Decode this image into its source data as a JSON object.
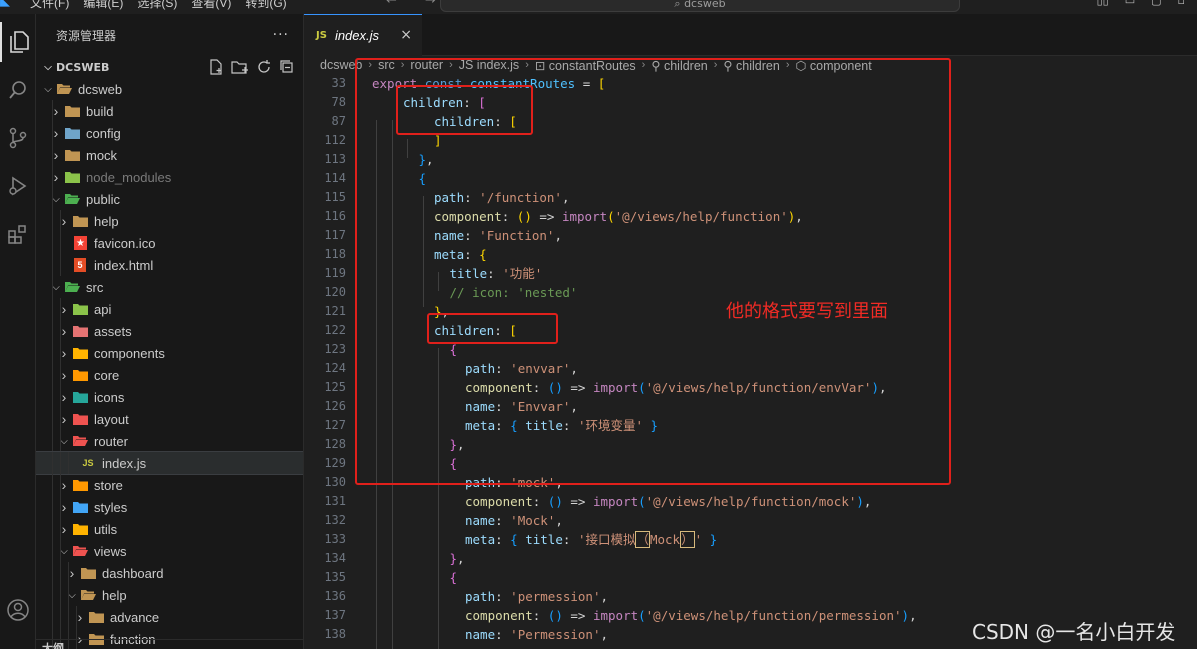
{
  "titlebar": {
    "menu": [
      "文件(F)",
      "编辑(E)",
      "选择(S)",
      "查看(V)",
      "转到(G)"
    ],
    "more": "···",
    "nav": "← →",
    "search": "⌕ dcsweb",
    "window_controls": [
      "▯▯",
      "▭",
      "▢",
      "▫"
    ]
  },
  "sidebar": {
    "title": "资源管理器",
    "more": "···",
    "section": "DCSWEB",
    "outline": "大纲",
    "items": [
      {
        "label": "dcsweb",
        "depth": 1,
        "open": true,
        "icon": "folder",
        "color": "#c09553"
      },
      {
        "label": "build",
        "depth": 2,
        "open": false,
        "icon": "folder",
        "color": "#c09553"
      },
      {
        "label": "config",
        "depth": 2,
        "open": false,
        "icon": "folder",
        "color": "#6fa4c9"
      },
      {
        "label": "mock",
        "depth": 2,
        "open": false,
        "icon": "folder",
        "color": "#c09553"
      },
      {
        "label": "node_modules",
        "depth": 2,
        "open": false,
        "icon": "folder",
        "color": "#8bc34a",
        "dim": true
      },
      {
        "label": "public",
        "depth": 2,
        "open": true,
        "icon": "folder",
        "color": "#4caf50"
      },
      {
        "label": "help",
        "depth": 3,
        "open": false,
        "icon": "folder",
        "color": "#c09553"
      },
      {
        "label": "favicon.ico",
        "depth": 3,
        "file": true,
        "icon": "star",
        "color": "#f44336"
      },
      {
        "label": "index.html",
        "depth": 3,
        "file": true,
        "icon": "html",
        "color": "#e44d26"
      },
      {
        "label": "src",
        "depth": 2,
        "open": true,
        "icon": "folder",
        "color": "#4caf50"
      },
      {
        "label": "api",
        "depth": 3,
        "open": false,
        "icon": "folder",
        "color": "#8bc34a"
      },
      {
        "label": "assets",
        "depth": 3,
        "open": false,
        "icon": "folder",
        "color": "#e57373"
      },
      {
        "label": "components",
        "depth": 3,
        "open": false,
        "icon": "folder",
        "color": "#ffb300"
      },
      {
        "label": "core",
        "depth": 3,
        "open": false,
        "icon": "folder",
        "color": "#ff9800"
      },
      {
        "label": "icons",
        "depth": 3,
        "open": false,
        "icon": "folder",
        "color": "#26a69a"
      },
      {
        "label": "layout",
        "depth": 3,
        "open": false,
        "icon": "folder",
        "color": "#ef5350"
      },
      {
        "label": "router",
        "depth": 3,
        "open": true,
        "icon": "folder",
        "color": "#ef5350"
      },
      {
        "label": "index.js",
        "depth": 4,
        "file": true,
        "icon": "js",
        "color": "#cbcb41",
        "selected": true
      },
      {
        "label": "store",
        "depth": 3,
        "open": false,
        "icon": "folder",
        "color": "#ff9800"
      },
      {
        "label": "styles",
        "depth": 3,
        "open": false,
        "icon": "folder",
        "color": "#42a5f5"
      },
      {
        "label": "utils",
        "depth": 3,
        "open": false,
        "icon": "folder",
        "color": "#ffb300"
      },
      {
        "label": "views",
        "depth": 3,
        "open": true,
        "icon": "folder",
        "color": "#ef5350"
      },
      {
        "label": "dashboard",
        "depth": 4,
        "open": false,
        "icon": "folder",
        "color": "#c09553"
      },
      {
        "label": "help",
        "depth": 4,
        "open": true,
        "icon": "folder",
        "color": "#c09553"
      },
      {
        "label": "advance",
        "depth": 5,
        "open": false,
        "icon": "folder",
        "color": "#c09553"
      },
      {
        "label": "function",
        "depth": 5,
        "open": false,
        "icon": "folder",
        "color": "#c09553"
      }
    ]
  },
  "editor": {
    "tab": {
      "badge": "JS",
      "name": "index.js",
      "close": "×"
    },
    "breadcrumb": [
      "dcsweb",
      "src",
      "router",
      "JS index.js",
      "⊡ constantRoutes",
      "⚲ children",
      "⚲ children",
      "⬡ component"
    ],
    "lines": [
      {
        "n": "33",
        "indent": 0,
        "tokens": [
          [
            "kw",
            "export "
          ],
          [
            "kb",
            "const "
          ],
          [
            "vr",
            "constantRoutes "
          ],
          [
            "op",
            "= "
          ],
          [
            "b1",
            "["
          ]
        ]
      },
      {
        "n": "78",
        "indent": 1,
        "tokens": [
          [
            "pr",
            "children"
          ],
          [
            "op",
            ": "
          ],
          [
            "b2",
            "["
          ]
        ]
      },
      {
        "n": "87",
        "indent": 2,
        "tokens": [
          [
            "pr",
            "children"
          ],
          [
            "op",
            ": "
          ],
          [
            "b1",
            "["
          ]
        ]
      },
      {
        "n": "112",
        "indent": 2,
        "tokens": [
          [
            "b1",
            "]"
          ]
        ]
      },
      {
        "n": "113",
        "indent": 1.5,
        "tokens": [
          [
            "b3",
            "}"
          ],
          [
            "op",
            ","
          ]
        ]
      },
      {
        "n": "114",
        "indent": 1.5,
        "tokens": [
          [
            "b3",
            "{"
          ]
        ]
      },
      {
        "n": "115",
        "indent": 2,
        "tokens": [
          [
            "pr",
            "path"
          ],
          [
            "op",
            ": "
          ],
          [
            "st",
            "'/function'"
          ],
          [
            "op",
            ","
          ]
        ]
      },
      {
        "n": "116",
        "indent": 2,
        "tokens": [
          [
            "fn",
            "component"
          ],
          [
            "op",
            ": "
          ],
          [
            "b1",
            "()"
          ],
          [
            "op",
            " => "
          ],
          [
            "kw",
            "import"
          ],
          [
            "b1",
            "("
          ],
          [
            "st",
            "'@/views/help/function'"
          ],
          [
            "b1",
            ")"
          ],
          [
            "op",
            ","
          ]
        ]
      },
      {
        "n": "117",
        "indent": 2,
        "tokens": [
          [
            "pr",
            "name"
          ],
          [
            "op",
            ": "
          ],
          [
            "st",
            "'Function'"
          ],
          [
            "op",
            ","
          ]
        ]
      },
      {
        "n": "118",
        "indent": 2,
        "tokens": [
          [
            "pr",
            "meta"
          ],
          [
            "op",
            ": "
          ],
          [
            "b1",
            "{"
          ]
        ]
      },
      {
        "n": "119",
        "indent": 2.5,
        "tokens": [
          [
            "pr",
            "title"
          ],
          [
            "op",
            ": "
          ],
          [
            "st",
            "'功能'"
          ]
        ]
      },
      {
        "n": "120",
        "indent": 2.5,
        "tokens": [
          [
            "cm",
            "// icon: 'nested'"
          ]
        ]
      },
      {
        "n": "121",
        "indent": 2,
        "tokens": [
          [
            "b1",
            "}"
          ],
          [
            "op",
            ","
          ]
        ]
      },
      {
        "n": "122",
        "indent": 2,
        "tokens": [
          [
            "pr",
            "children"
          ],
          [
            "op",
            ": "
          ],
          [
            "b1",
            "["
          ]
        ]
      },
      {
        "n": "123",
        "indent": 2.5,
        "tokens": [
          [
            "b2",
            "{"
          ]
        ]
      },
      {
        "n": "124",
        "indent": 3,
        "tokens": [
          [
            "pr",
            "path"
          ],
          [
            "op",
            ": "
          ],
          [
            "st",
            "'envvar'"
          ],
          [
            "op",
            ","
          ]
        ]
      },
      {
        "n": "125",
        "indent": 3,
        "tokens": [
          [
            "fn",
            "component"
          ],
          [
            "op",
            ": "
          ],
          [
            "b3",
            "()"
          ],
          [
            "op",
            " => "
          ],
          [
            "kw",
            "import"
          ],
          [
            "b3",
            "("
          ],
          [
            "st",
            "'@/views/help/function/envVar'"
          ],
          [
            "b3",
            ")"
          ],
          [
            "op",
            ","
          ]
        ]
      },
      {
        "n": "126",
        "indent": 3,
        "tokens": [
          [
            "pr",
            "name"
          ],
          [
            "op",
            ": "
          ],
          [
            "st",
            "'Envvar'"
          ],
          [
            "op",
            ","
          ]
        ]
      },
      {
        "n": "127",
        "indent": 3,
        "tokens": [
          [
            "pr",
            "meta"
          ],
          [
            "op",
            ": "
          ],
          [
            "b3",
            "{ "
          ],
          [
            "pr",
            "title"
          ],
          [
            "op",
            ": "
          ],
          [
            "st",
            "'环境变量'"
          ],
          [
            "b3",
            " }"
          ]
        ]
      },
      {
        "n": "128",
        "indent": 2.5,
        "tokens": [
          [
            "b2",
            "}"
          ],
          [
            "op",
            ","
          ]
        ]
      },
      {
        "n": "129",
        "indent": 2.5,
        "tokens": [
          [
            "b2",
            "{"
          ]
        ]
      },
      {
        "n": "130",
        "indent": 3,
        "tokens": [
          [
            "pr",
            "path"
          ],
          [
            "op",
            ": "
          ],
          [
            "st",
            "'mock'"
          ],
          [
            "op",
            ","
          ]
        ]
      },
      {
        "n": "131",
        "indent": 3,
        "tokens": [
          [
            "fn",
            "component"
          ],
          [
            "op",
            ": "
          ],
          [
            "b3",
            "()"
          ],
          [
            "op",
            " => "
          ],
          [
            "kw",
            "import"
          ],
          [
            "b3",
            "("
          ],
          [
            "st",
            "'@/views/help/function/mock'"
          ],
          [
            "b3",
            ")"
          ],
          [
            "op",
            ","
          ]
        ]
      },
      {
        "n": "132",
        "indent": 3,
        "tokens": [
          [
            "pr",
            "name"
          ],
          [
            "op",
            ": "
          ],
          [
            "st",
            "'Mock'"
          ],
          [
            "op",
            ","
          ]
        ]
      },
      {
        "n": "133",
        "indent": 3,
        "tokens": [
          [
            "pr",
            "meta"
          ],
          [
            "op",
            ": "
          ],
          [
            "b3",
            "{ "
          ],
          [
            "pr",
            "title"
          ],
          [
            "op",
            ": "
          ],
          [
            "st",
            "'接口模拟"
          ],
          [
            "hl",
            "（"
          ],
          [
            "st",
            "Mock"
          ],
          [
            "hl",
            "）"
          ],
          [
            "st",
            "'"
          ],
          [
            "b3",
            " }"
          ]
        ]
      },
      {
        "n": "134",
        "indent": 2.5,
        "tokens": [
          [
            "b2",
            "}"
          ],
          [
            "op",
            ","
          ]
        ]
      },
      {
        "n": "135",
        "indent": 2.5,
        "tokens": [
          [
            "b2",
            "{"
          ]
        ]
      },
      {
        "n": "136",
        "indent": 3,
        "tokens": [
          [
            "pr",
            "path"
          ],
          [
            "op",
            ": "
          ],
          [
            "st",
            "'permession'"
          ],
          [
            "op",
            ","
          ]
        ]
      },
      {
        "n": "137",
        "indent": 3,
        "tokens": [
          [
            "fn",
            "component"
          ],
          [
            "op",
            ": "
          ],
          [
            "b3",
            "()"
          ],
          [
            "op",
            " => "
          ],
          [
            "kw",
            "import"
          ],
          [
            "b3",
            "("
          ],
          [
            "st",
            "'@/views/help/function/permession'"
          ],
          [
            "b3",
            ")"
          ],
          [
            "op",
            ","
          ]
        ]
      },
      {
        "n": "138",
        "indent": 3,
        "tokens": [
          [
            "pr",
            "name"
          ],
          [
            "op",
            ": "
          ],
          [
            "st",
            "'Permession'"
          ],
          [
            "op",
            ","
          ]
        ]
      }
    ]
  },
  "annotation": "他的格式要写到里面",
  "watermark": "CSDN @一名小白开发"
}
